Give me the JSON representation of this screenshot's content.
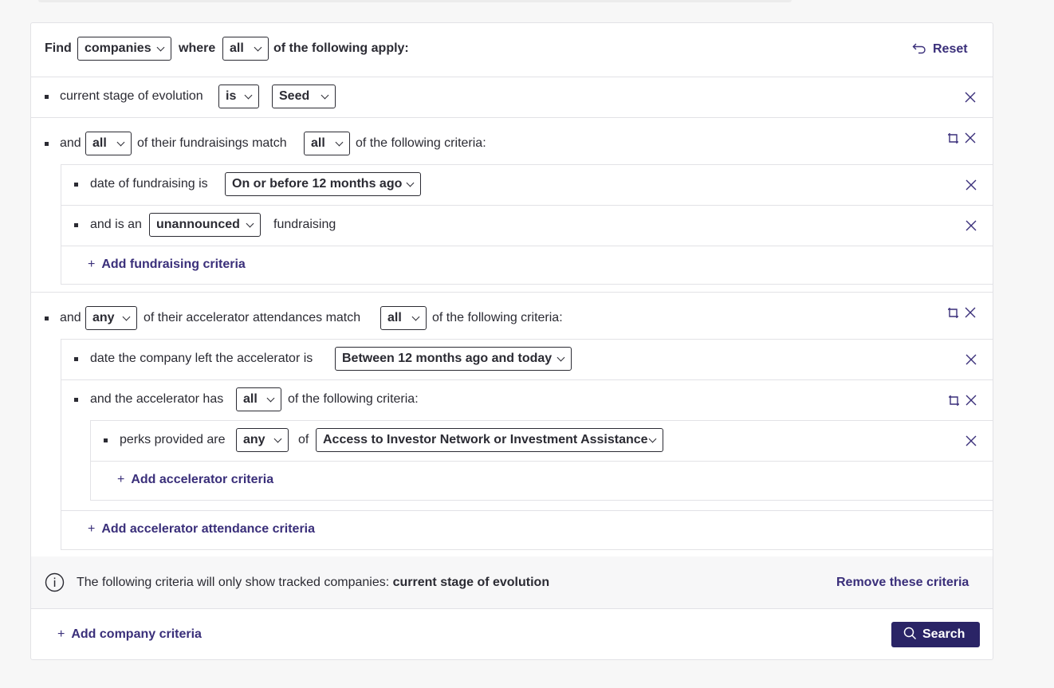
{
  "header": {
    "find_label": "Find",
    "entity_value": "companies",
    "where_label": "where",
    "quantifier_value": "all",
    "suffix_label": "of the following apply:",
    "reset_label": "Reset"
  },
  "criteria": {
    "stage": {
      "label": "current stage of evolution",
      "operator_value": "is",
      "value": "Seed"
    },
    "fundraising": {
      "and_label": "and",
      "quantifier_value": "all",
      "middle_label": "of their fundraisings match",
      "match_value": "all",
      "suffix_label": "of the following criteria:",
      "date_label": "date of fundraising is",
      "date_value": "On or before 12 months ago",
      "type_label": "and is an",
      "type_value": "unannounced",
      "type_suffix": "fundraising",
      "add_label": "Add fundraising criteria"
    },
    "accelerator": {
      "and_label": "and",
      "quantifier_value": "any",
      "middle_label": "of their accelerator attendances match",
      "match_value": "all",
      "suffix_label": "of the following criteria:",
      "date_label": "date the company left the accelerator is",
      "date_value": "Between 12 months ago and today",
      "has_label": "and the accelerator has",
      "has_value": "all",
      "has_suffix": "of the following criteria:",
      "perks_label": "perks provided are",
      "perks_quantifier": "any",
      "perks_of": "of",
      "perks_value": "Access to Investor Network or Investment Assistance",
      "add_inner_label": "Add accelerator criteria",
      "add_outer_label": "Add accelerator attendance criteria"
    }
  },
  "notice": {
    "text": "The following criteria will only show tracked companies:",
    "field": "current stage of evolution",
    "remove_label": "Remove these criteria"
  },
  "footer": {
    "add_label": "Add company criteria",
    "search_label": "Search"
  },
  "colors": {
    "accent": "#3a2f7a",
    "search_bg": "#2a2466",
    "border": "#e2e2e6"
  }
}
